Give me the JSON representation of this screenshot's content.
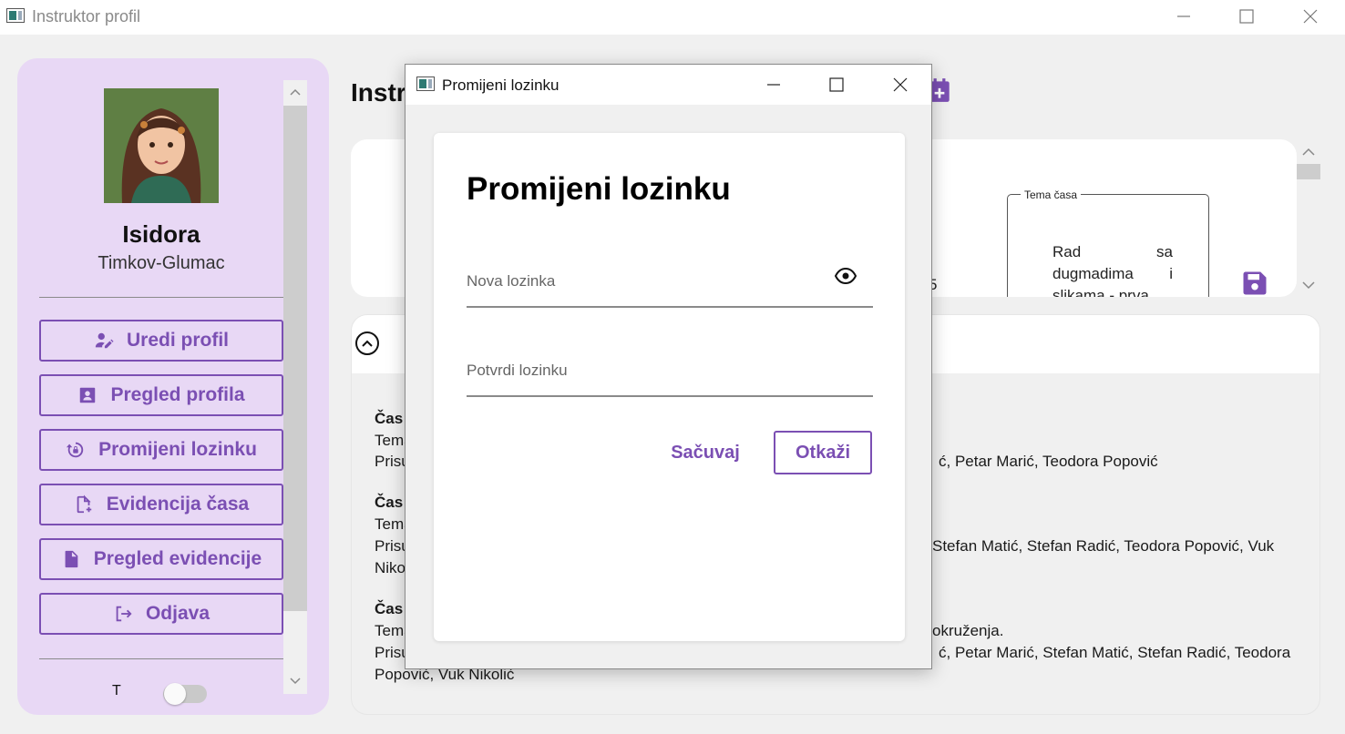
{
  "window": {
    "title": "Instruktor profil"
  },
  "profile": {
    "first_name": "Isidora",
    "last_name": "Timkov-Glumac"
  },
  "sidebar": {
    "items": [
      {
        "label": "Uredi profil",
        "icon": "edit-user-icon"
      },
      {
        "label": "Pregled profila",
        "icon": "profile-card-icon"
      },
      {
        "label": "Promijeni lozinku",
        "icon": "lock-reset-icon"
      },
      {
        "label": "Evidencija časa",
        "icon": "document-add-icon"
      },
      {
        "label": "Pregled evidencije",
        "icon": "document-icon"
      },
      {
        "label": "Odjava",
        "icon": "logout-icon"
      }
    ],
    "theme_label": "T"
  },
  "main": {
    "heading": "Instr",
    "tema_legend": "Tema časa",
    "tema_text": "Rad sa dugmadima i slikama - prva",
    "digit": "5",
    "entries": [
      {
        "cas": "Čas",
        "tema": "Tema",
        "prisutni": "Prisu",
        "tail1": "ć, Petar Marić, Teodora Popović"
      },
      {
        "cas": "Čas",
        "tema": "Tema",
        "prisutni": "Prisu",
        "tail1": "Stefan Matić, Stefan Radić, Teodora Popović, Vuk",
        "tail2": "Niko"
      },
      {
        "cas": "Čas",
        "tema": "Tema",
        "tema_tail": "okruženja.",
        "prisutni": "Prisu",
        "tail1": "ć, Petar Marić, Stefan Matić, Stefan Radić, Teodora",
        "tail2": "Popović, Vuk Nikolić"
      }
    ]
  },
  "dialog": {
    "window_title": "Promijeni lozinku",
    "heading": "Promijeni lozinku",
    "new_password_placeholder": "Nova lozinka",
    "confirm_password_placeholder": "Potvrdi lozinku",
    "save_label": "Sačuvaj",
    "cancel_label": "Otkaži"
  },
  "colors": {
    "accent": "#7b4fb3",
    "sidebar_bg": "#e8d8f5"
  }
}
